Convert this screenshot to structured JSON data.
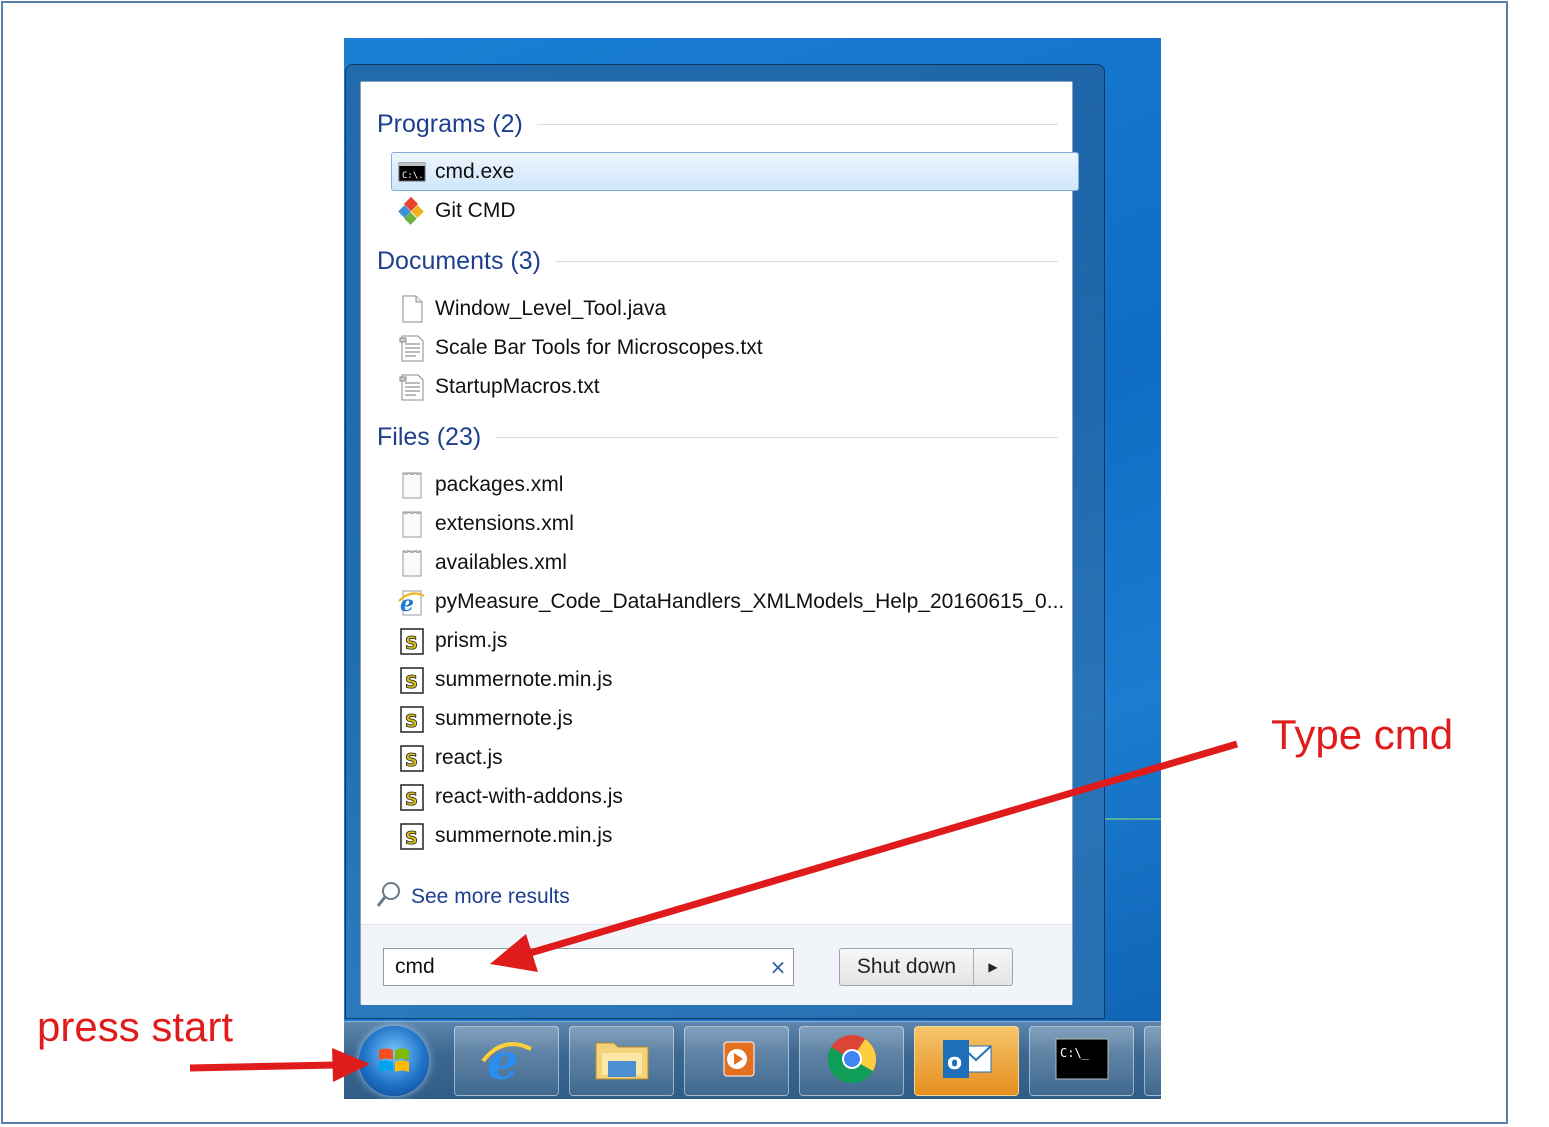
{
  "start_menu": {
    "sections": [
      {
        "title": "Programs (2)",
        "items": [
          {
            "label": "cmd.exe",
            "icon": "cmd-icon",
            "selected": true
          },
          {
            "label": "Git CMD",
            "icon": "git-icon"
          }
        ]
      },
      {
        "title": "Documents (3)",
        "items": [
          {
            "label": "Window_Level_Tool.java",
            "icon": "document-icon"
          },
          {
            "label": "Scale Bar Tools for Microscopes.txt",
            "icon": "text-file-icon"
          },
          {
            "label": "StartupMacros.txt",
            "icon": "text-file-icon"
          }
        ]
      },
      {
        "title": "Files (23)",
        "items": [
          {
            "label": "packages.xml",
            "icon": "xml-file-icon"
          },
          {
            "label": "extensions.xml",
            "icon": "xml-file-icon"
          },
          {
            "label": "availables.xml",
            "icon": "xml-file-icon"
          },
          {
            "label": "pyMeasure_Code_DataHandlers_XMLModels_Help_20160615_0...",
            "icon": "internet-explorer-icon"
          },
          {
            "label": "prism.js",
            "icon": "script-file-icon"
          },
          {
            "label": "summernote.min.js",
            "icon": "script-file-icon"
          },
          {
            "label": "summernote.js",
            "icon": "script-file-icon"
          },
          {
            "label": "react.js",
            "icon": "script-file-icon"
          },
          {
            "label": "react-with-addons.js",
            "icon": "script-file-icon"
          },
          {
            "label": "summernote.min.js",
            "icon": "script-file-icon"
          }
        ]
      }
    ],
    "see_more": "See more results",
    "search": {
      "value": "cmd",
      "clear_icon": "×"
    },
    "shutdown": {
      "label": "Shut down",
      "arrow": "▶"
    }
  },
  "taskbar": {
    "items": [
      "start-orb-icon",
      "internet-explorer-icon",
      "file-explorer-icon",
      "media-player-icon",
      "chrome-icon",
      "outlook-icon",
      "command-prompt-icon"
    ],
    "active_item": "outlook-icon"
  },
  "annotations": {
    "press_start": "press start",
    "type_cmd": "Type cmd",
    "color": "#e01b1b"
  }
}
